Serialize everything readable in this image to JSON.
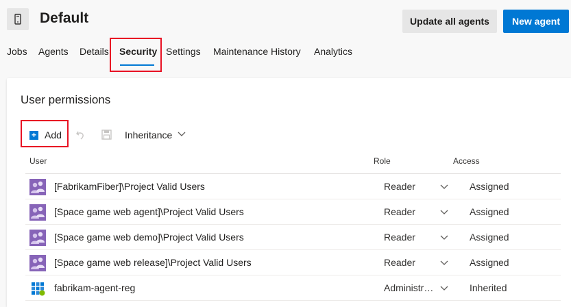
{
  "header": {
    "title": "Default",
    "update_button": "Update all agents",
    "new_agent_button": "New agent"
  },
  "tabs": [
    {
      "label": "Jobs"
    },
    {
      "label": "Agents"
    },
    {
      "label": "Details"
    },
    {
      "label": "Security",
      "active": true
    },
    {
      "label": "Settings"
    },
    {
      "label": "Maintenance History"
    },
    {
      "label": "Analytics"
    }
  ],
  "permissions": {
    "title": "User permissions",
    "toolbar": {
      "add_label": "Add",
      "inheritance_label": "Inheritance"
    },
    "columns": {
      "user": "User",
      "role": "Role",
      "access": "Access"
    },
    "rows": [
      {
        "user": "[FabrikamFiber]\\Project Valid Users",
        "role": "Reader",
        "access": "Assigned",
        "icon": "group-icon"
      },
      {
        "user": "[Space game web agent]\\Project Valid Users",
        "role": "Reader",
        "access": "Assigned",
        "icon": "group-icon"
      },
      {
        "user": "[Space game web demo]\\Project Valid Users",
        "role": "Reader",
        "access": "Assigned",
        "icon": "group-icon"
      },
      {
        "user": "[Space game web release]\\Project Valid Users",
        "role": "Reader",
        "access": "Assigned",
        "icon": "group-icon"
      },
      {
        "user": "fabrikam-agent-reg",
        "role": "Administr…",
        "access": "Inherited",
        "icon": "service-principal-icon"
      }
    ]
  },
  "colors": {
    "accent": "#0078d4",
    "highlight": "#e81123",
    "group_avatar": "#8764b8"
  }
}
